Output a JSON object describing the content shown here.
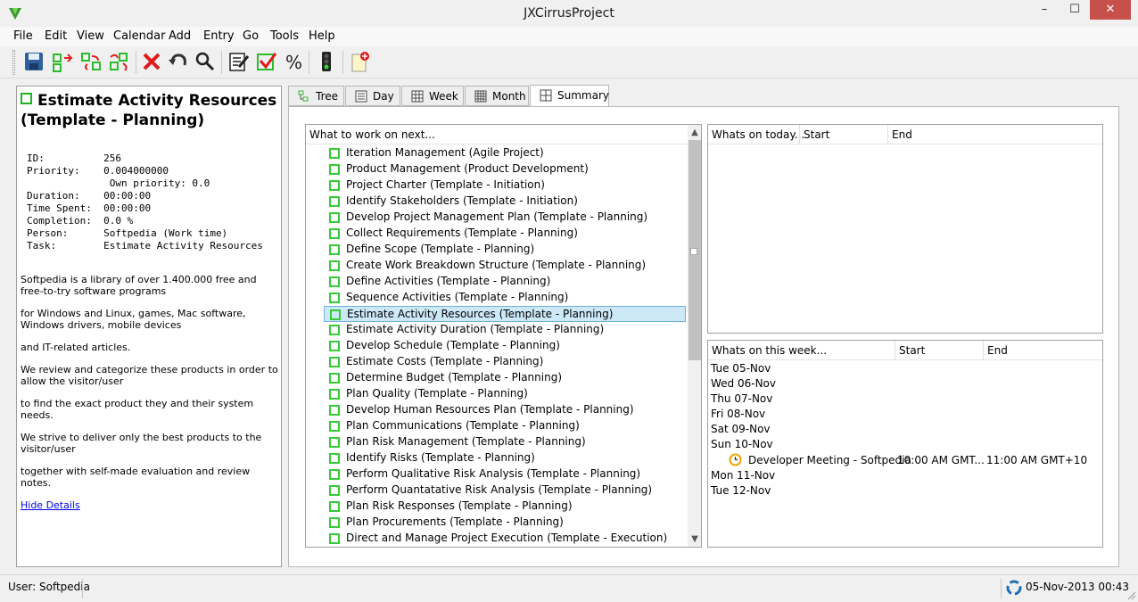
{
  "window": {
    "title": "JXCirrusProject",
    "minimize_glyph": "–",
    "maximize_glyph": "☐",
    "close_glyph": "✕"
  },
  "menu": [
    "File",
    "Edit",
    "View",
    "Calendar",
    "Add",
    "Entry",
    "Go",
    "Tools",
    "Help"
  ],
  "toolbar_icons": [
    "save-icon",
    "move-out-icon",
    "move-swap-icon",
    "move-in-icon",
    "delete-icon",
    "undo-icon",
    "search-icon",
    "edit-entry-icon",
    "complete-icon",
    "percent-icon",
    "traffic-light-icon",
    "new-note-icon"
  ],
  "task": {
    "title": "Estimate Activity Resources (Template - Planning)",
    "details": [
      {
        "label": "ID:",
        "value": "256"
      },
      {
        "label": "Priority:",
        "value": "0.004000000"
      },
      {
        "label": "",
        "value": "Own priority: 0.0"
      },
      {
        "label": "Duration:",
        "value": "00:00:00"
      },
      {
        "label": "Time Spent:",
        "value": "00:00:00"
      },
      {
        "label": "Completion:",
        "value": "0.0 %"
      },
      {
        "label": "Person:",
        "value": "Softpedia (Work time)"
      },
      {
        "label": "Task:",
        "value": "Estimate Activity Resources"
      }
    ],
    "description": [
      "Softpedia is a library of over 1.400.000 free and free-to-try software programs",
      "for Windows and Linux, games, Mac software, Windows drivers, mobile devices",
      "and IT-related articles.",
      "We review and categorize these products in order to allow the visitor/user",
      "to find the exact product they and their system needs.",
      "We strive to deliver only the best products to the visitor/user",
      "together with self-made evaluation and review notes."
    ],
    "hide_link": "Hide Details"
  },
  "tabs": [
    {
      "label": "Tree",
      "icon": "tree-icon"
    },
    {
      "label": "Day",
      "icon": "day-icon"
    },
    {
      "label": "Week",
      "icon": "week-icon"
    },
    {
      "label": "Month",
      "icon": "month-icon"
    },
    {
      "label": "Summary",
      "icon": "summary-icon",
      "active": true
    }
  ],
  "next": {
    "header": "What to work on next...",
    "items": [
      "Iteration Management (Agile Project)",
      "Product Management (Product Development)",
      "Project Charter (Template - Initiation)",
      "Identify Stakeholders (Template - Initiation)",
      "Develop Project Management Plan (Template - Planning)",
      "Collect Requirements (Template - Planning)",
      "Define Scope (Template - Planning)",
      "Create Work Breakdown Structure (Template - Planning)",
      "Define Activities (Template - Planning)",
      "Sequence Activities (Template - Planning)",
      "Estimate Activity Resources (Template - Planning)",
      "Estimate Activity Duration (Template - Planning)",
      "Develop Schedule (Template - Planning)",
      "Estimate Costs (Template - Planning)",
      "Determine Budget (Template - Planning)",
      "Plan Quality (Template - Planning)",
      "Develop Human Resources Plan (Template - Planning)",
      "Plan Communications (Template - Planning)",
      "Plan Risk Management (Template - Planning)",
      "Identify Risks (Template - Planning)",
      "Perform Qualitative Risk Analysis (Template - Planning)",
      "Perform Quantatative Risk Analysis (Template - Planning)",
      "Plan Risk Responses (Template - Planning)",
      "Plan Procurements (Template - Planning)",
      "Direct and Manage Project Execution (Template - Execution)"
    ],
    "selected_index": 10
  },
  "today": {
    "col1": "Whats on today...",
    "col2": "Start",
    "col3": "End"
  },
  "week": {
    "col1": "Whats on this week...",
    "col2": "Start",
    "col3": "End",
    "days": [
      "Tue 05-Nov",
      "Wed 06-Nov",
      "Thu 07-Nov",
      "Fri 08-Nov",
      "Sat 09-Nov",
      "Sun 10-Nov"
    ],
    "event": {
      "name": "Developer Meeting - Softpedia",
      "start": "10:00 AM GMT...",
      "end": "11:00 AM GMT+10"
    },
    "days_after": [
      "Mon 11-Nov",
      "Tue 12-Nov"
    ]
  },
  "status": {
    "user": "User: Softpedia",
    "datetime": "05-Nov-2013 00:43"
  },
  "colors": {
    "check_green": "#33cc33",
    "selection": "#cde8f7",
    "close_red": "#c7504b"
  }
}
